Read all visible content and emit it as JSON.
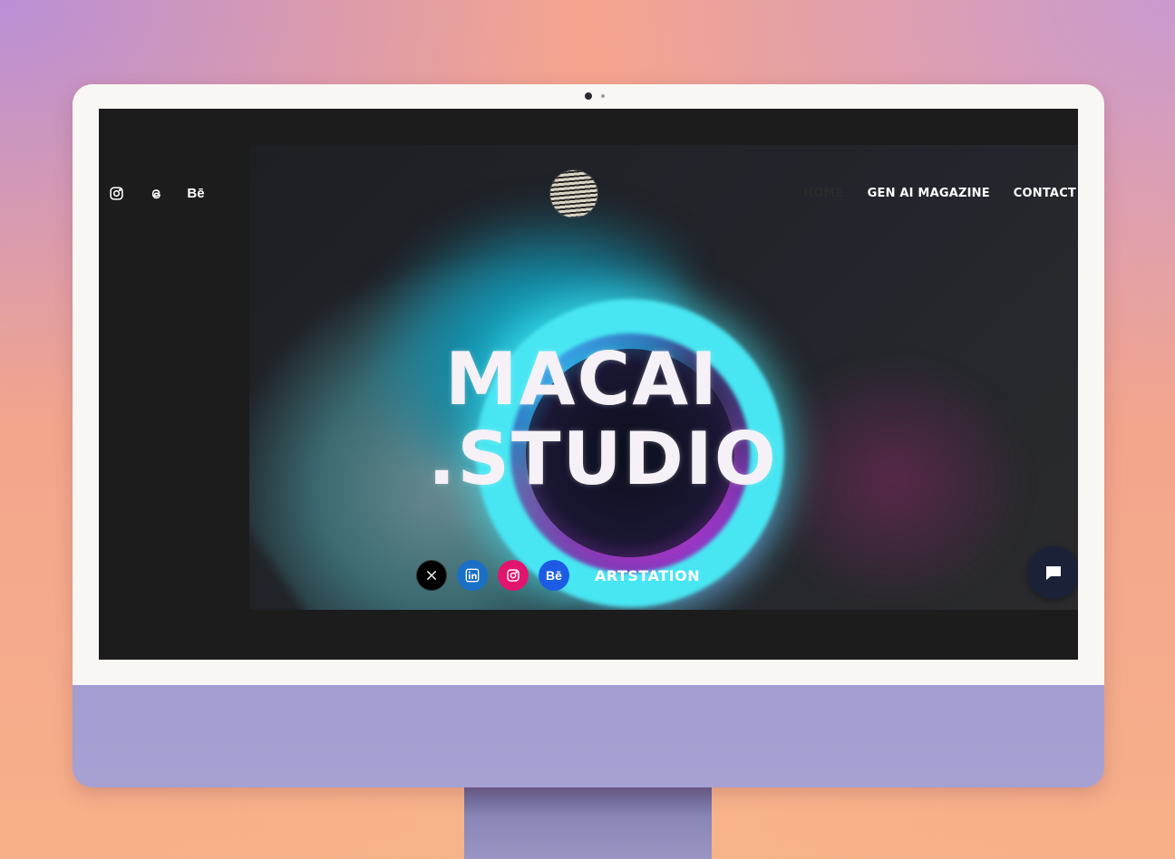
{
  "header": {
    "social_icons": [
      "instagram-icon",
      "threads-icon",
      "behance-icon"
    ],
    "behance_label": "Bē",
    "nav": [
      {
        "label": "HOME",
        "active": true
      },
      {
        "label": "GEN AI MAGAZINE",
        "active": false
      },
      {
        "label": "CONTACT",
        "active": false
      }
    ]
  },
  "hero": {
    "title_line1": "MACAI",
    "title_line2": ".STUDIO",
    "socials": [
      {
        "icon": "x-icon",
        "label": "𝕏"
      },
      {
        "icon": "linkedin-icon",
        "label": "in"
      },
      {
        "icon": "instagram-icon",
        "label": ""
      },
      {
        "icon": "behance-icon",
        "label": "Bē"
      }
    ],
    "artstation_label": "ARTSTATION"
  },
  "colors": {
    "screen_bg": "#1c1c1c",
    "chin": "#a6a0d3",
    "chat_bg": "#1b2238"
  }
}
